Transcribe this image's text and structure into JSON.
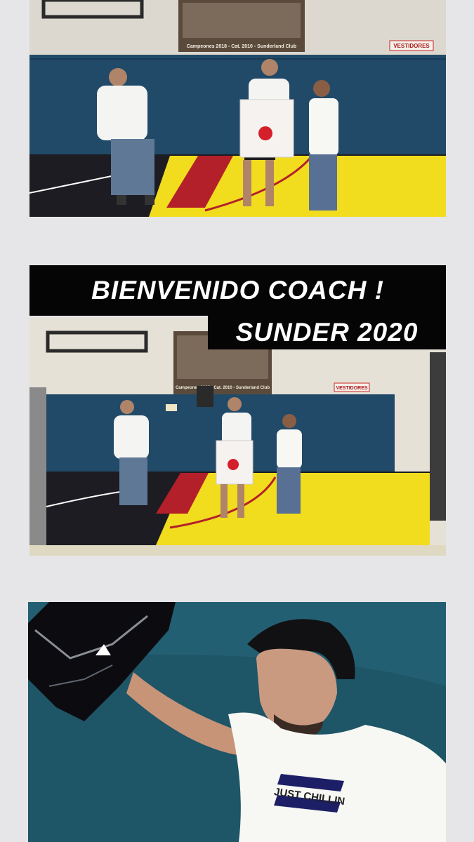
{
  "story": {
    "caption_line_1": "BIENVENIDO COACH !",
    "caption_line_2": "SUNDER 2020"
  },
  "photos": {
    "photo1": {
      "banner_text": "Campeones 2018 - Cat. 2010 - Sunderland Club",
      "sign_text": "VESTIDORES"
    },
    "photo2": {
      "banner_text": "Campeones 2018 - Cat. 2010 - Sunderland Club",
      "sign_text": "VESTIDORES"
    },
    "photo3": {
      "shirt_text": "JUST CHILLIN"
    }
  },
  "colors": {
    "page_bg": "#e6e6e8",
    "caption_bg": "#050505",
    "caption_text": "#ffffff",
    "wall_padding": "#214a68",
    "court_yellow": "#f2dc1e",
    "court_red": "#b3202a",
    "court_dark": "#1c1c22"
  }
}
